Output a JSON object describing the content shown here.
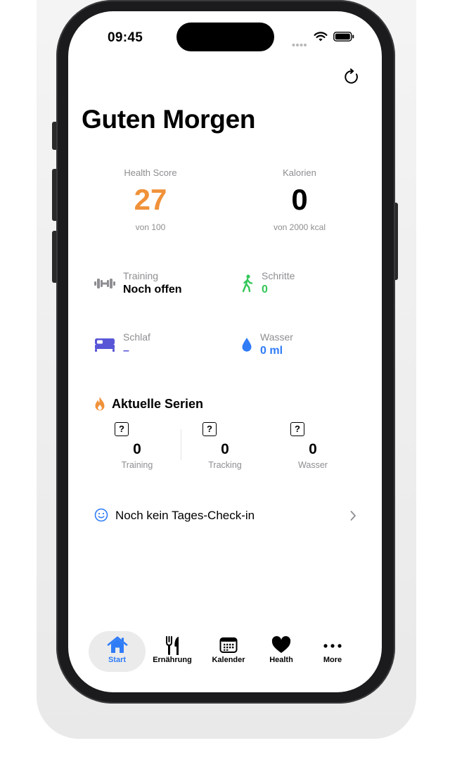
{
  "status_bar": {
    "time": "09:45"
  },
  "header": {
    "refresh_icon": "refresh-icon",
    "title": "Guten Morgen"
  },
  "metrics": {
    "health_score": {
      "label": "Health Score",
      "value": "27",
      "sub": "von 100",
      "color": "#F0923A"
    },
    "calories": {
      "label": "Kalorien",
      "value": "0",
      "sub": "von 2000 kcal"
    }
  },
  "tiles": {
    "training": {
      "label": "Training",
      "value": "Noch offen",
      "icon": "dumbbell-icon"
    },
    "steps": {
      "label": "Schritte",
      "value": "0",
      "icon": "walking-icon",
      "color": "#34C759"
    },
    "sleep": {
      "label": "Schlaf",
      "value": "–",
      "icon": "bed-icon",
      "color": "#5856D6"
    },
    "water": {
      "label": "Wasser",
      "value": "0 ml",
      "icon": "water-drop-icon",
      "color": "#2F7CF6"
    }
  },
  "streaks": {
    "title": "Aktuelle Serien",
    "icon": "flame-icon",
    "items": [
      {
        "value": "0",
        "label": "Training",
        "icon": "question-box-icon"
      },
      {
        "value": "0",
        "label": "Tracking",
        "icon": "question-box-icon"
      },
      {
        "value": "0",
        "label": "Wasser",
        "icon": "question-box-icon"
      }
    ]
  },
  "checkin": {
    "label": "Noch kein Tages-Check-in",
    "icon": "smiley-icon"
  },
  "tab_bar": {
    "active_color": "#2F7CF6",
    "tabs": [
      {
        "label": "Start",
        "icon": "house-icon"
      },
      {
        "label": "Ernährung",
        "icon": "fork-knife-icon"
      },
      {
        "label": "Kalender",
        "icon": "calendar-icon"
      },
      {
        "label": "Health",
        "icon": "heart-icon"
      },
      {
        "label": "More",
        "icon": "ellipsis-icon"
      }
    ]
  }
}
